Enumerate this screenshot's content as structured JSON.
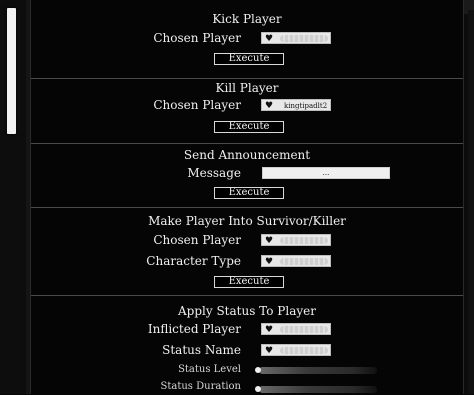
{
  "sections": {
    "kick": {
      "title": "Kick Player",
      "chosen_label": "Chosen Player",
      "execute_label": "Execute"
    },
    "kill": {
      "title": "Kill Player",
      "chosen_label": "Chosen Player",
      "chosen_value": "kingtipadlt2",
      "execute_label": "Execute"
    },
    "announce": {
      "title": "Send Announcement",
      "message_label": "Message",
      "message_value": "...",
      "execute_label": "Execute"
    },
    "survivor_killer": {
      "title": "Make Player Into Survivor/Killer",
      "chosen_label": "Chosen Player",
      "type_label": "Character Type",
      "execute_label": "Execute"
    },
    "status": {
      "title": "Apply Status To Player",
      "inflicted_label": "Inflicted Player",
      "status_name_label": "Status Name",
      "status_level_label": "Status Level",
      "status_duration_label": "Status Duration"
    }
  },
  "icons": {
    "selector_icon": "heart-icon"
  },
  "colors": {
    "panel_bg": "#050505",
    "text": "#f0f0f0",
    "selector_bg": "#e8e8e8",
    "scroll_thumb": "#f2f2f2"
  }
}
